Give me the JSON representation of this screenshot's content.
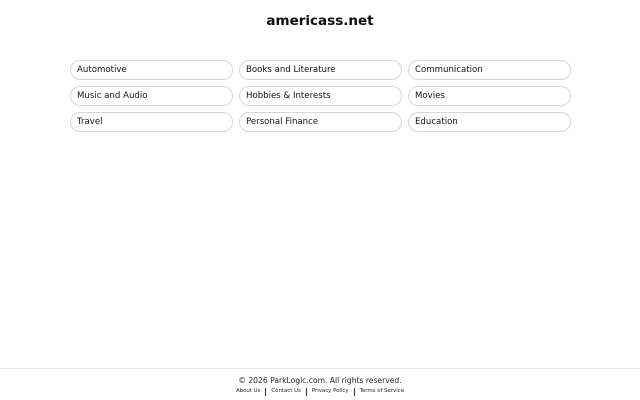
{
  "header": {
    "title": "americass.net"
  },
  "categories": [
    "Automotive",
    "Books and Literature",
    "Communication",
    "Music and Audio",
    "Hobbies & Interests",
    "Movies",
    "Travel",
    "Personal Finance",
    "Education"
  ],
  "footer": {
    "copyright": "© 2026 ParkLogic.com. All rights reserved.",
    "links": [
      "About Us",
      "Contact Us",
      "Privacy Policy",
      "Terms of Service"
    ]
  }
}
